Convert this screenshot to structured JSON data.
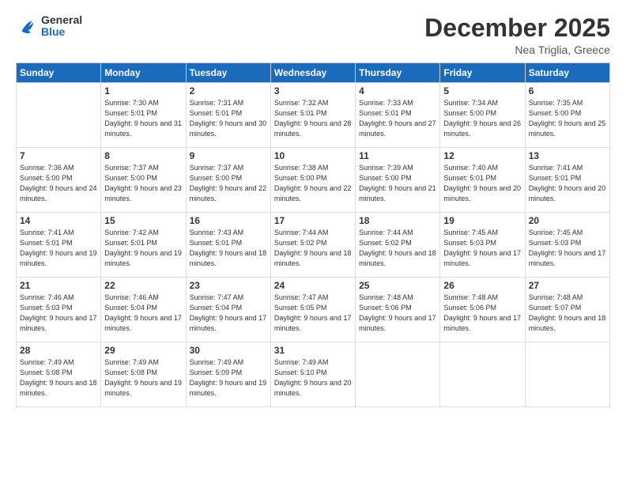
{
  "logo": {
    "line1": "General",
    "line2": "Blue"
  },
  "header": {
    "month": "December 2025",
    "location": "Nea Triglia, Greece"
  },
  "weekdays": [
    "Sunday",
    "Monday",
    "Tuesday",
    "Wednesday",
    "Thursday",
    "Friday",
    "Saturday"
  ],
  "weeks": [
    [
      {
        "day": "",
        "sunrise": "",
        "sunset": "",
        "daylight": ""
      },
      {
        "day": "1",
        "sunrise": "Sunrise: 7:30 AM",
        "sunset": "Sunset: 5:01 PM",
        "daylight": "Daylight: 9 hours and 31 minutes."
      },
      {
        "day": "2",
        "sunrise": "Sunrise: 7:31 AM",
        "sunset": "Sunset: 5:01 PM",
        "daylight": "Daylight: 9 hours and 30 minutes."
      },
      {
        "day": "3",
        "sunrise": "Sunrise: 7:32 AM",
        "sunset": "Sunset: 5:01 PM",
        "daylight": "Daylight: 9 hours and 28 minutes."
      },
      {
        "day": "4",
        "sunrise": "Sunrise: 7:33 AM",
        "sunset": "Sunset: 5:01 PM",
        "daylight": "Daylight: 9 hours and 27 minutes."
      },
      {
        "day": "5",
        "sunrise": "Sunrise: 7:34 AM",
        "sunset": "Sunset: 5:00 PM",
        "daylight": "Daylight: 9 hours and 26 minutes."
      },
      {
        "day": "6",
        "sunrise": "Sunrise: 7:35 AM",
        "sunset": "Sunset: 5:00 PM",
        "daylight": "Daylight: 9 hours and 25 minutes."
      }
    ],
    [
      {
        "day": "7",
        "sunrise": "Sunrise: 7:36 AM",
        "sunset": "Sunset: 5:00 PM",
        "daylight": "Daylight: 9 hours and 24 minutes."
      },
      {
        "day": "8",
        "sunrise": "Sunrise: 7:37 AM",
        "sunset": "Sunset: 5:00 PM",
        "daylight": "Daylight: 9 hours and 23 minutes."
      },
      {
        "day": "9",
        "sunrise": "Sunrise: 7:37 AM",
        "sunset": "Sunset: 5:00 PM",
        "daylight": "Daylight: 9 hours and 22 minutes."
      },
      {
        "day": "10",
        "sunrise": "Sunrise: 7:38 AM",
        "sunset": "Sunset: 5:00 PM",
        "daylight": "Daylight: 9 hours and 22 minutes."
      },
      {
        "day": "11",
        "sunrise": "Sunrise: 7:39 AM",
        "sunset": "Sunset: 5:00 PM",
        "daylight": "Daylight: 9 hours and 21 minutes."
      },
      {
        "day": "12",
        "sunrise": "Sunrise: 7:40 AM",
        "sunset": "Sunset: 5:01 PM",
        "daylight": "Daylight: 9 hours and 20 minutes."
      },
      {
        "day": "13",
        "sunrise": "Sunrise: 7:41 AM",
        "sunset": "Sunset: 5:01 PM",
        "daylight": "Daylight: 9 hours and 20 minutes."
      }
    ],
    [
      {
        "day": "14",
        "sunrise": "Sunrise: 7:41 AM",
        "sunset": "Sunset: 5:01 PM",
        "daylight": "Daylight: 9 hours and 19 minutes."
      },
      {
        "day": "15",
        "sunrise": "Sunrise: 7:42 AM",
        "sunset": "Sunset: 5:01 PM",
        "daylight": "Daylight: 9 hours and 19 minutes."
      },
      {
        "day": "16",
        "sunrise": "Sunrise: 7:43 AM",
        "sunset": "Sunset: 5:01 PM",
        "daylight": "Daylight: 9 hours and 18 minutes."
      },
      {
        "day": "17",
        "sunrise": "Sunrise: 7:44 AM",
        "sunset": "Sunset: 5:02 PM",
        "daylight": "Daylight: 9 hours and 18 minutes."
      },
      {
        "day": "18",
        "sunrise": "Sunrise: 7:44 AM",
        "sunset": "Sunset: 5:02 PM",
        "daylight": "Daylight: 9 hours and 18 minutes."
      },
      {
        "day": "19",
        "sunrise": "Sunrise: 7:45 AM",
        "sunset": "Sunset: 5:03 PM",
        "daylight": "Daylight: 9 hours and 17 minutes."
      },
      {
        "day": "20",
        "sunrise": "Sunrise: 7:45 AM",
        "sunset": "Sunset: 5:03 PM",
        "daylight": "Daylight: 9 hours and 17 minutes."
      }
    ],
    [
      {
        "day": "21",
        "sunrise": "Sunrise: 7:46 AM",
        "sunset": "Sunset: 5:03 PM",
        "daylight": "Daylight: 9 hours and 17 minutes."
      },
      {
        "day": "22",
        "sunrise": "Sunrise: 7:46 AM",
        "sunset": "Sunset: 5:04 PM",
        "daylight": "Daylight: 9 hours and 17 minutes."
      },
      {
        "day": "23",
        "sunrise": "Sunrise: 7:47 AM",
        "sunset": "Sunset: 5:04 PM",
        "daylight": "Daylight: 9 hours and 17 minutes."
      },
      {
        "day": "24",
        "sunrise": "Sunrise: 7:47 AM",
        "sunset": "Sunset: 5:05 PM",
        "daylight": "Daylight: 9 hours and 17 minutes."
      },
      {
        "day": "25",
        "sunrise": "Sunrise: 7:48 AM",
        "sunset": "Sunset: 5:06 PM",
        "daylight": "Daylight: 9 hours and 17 minutes."
      },
      {
        "day": "26",
        "sunrise": "Sunrise: 7:48 AM",
        "sunset": "Sunset: 5:06 PM",
        "daylight": "Daylight: 9 hours and 17 minutes."
      },
      {
        "day": "27",
        "sunrise": "Sunrise: 7:48 AM",
        "sunset": "Sunset: 5:07 PM",
        "daylight": "Daylight: 9 hours and 18 minutes."
      }
    ],
    [
      {
        "day": "28",
        "sunrise": "Sunrise: 7:49 AM",
        "sunset": "Sunset: 5:08 PM",
        "daylight": "Daylight: 9 hours and 18 minutes."
      },
      {
        "day": "29",
        "sunrise": "Sunrise: 7:49 AM",
        "sunset": "Sunset: 5:08 PM",
        "daylight": "Daylight: 9 hours and 19 minutes."
      },
      {
        "day": "30",
        "sunrise": "Sunrise: 7:49 AM",
        "sunset": "Sunset: 5:09 PM",
        "daylight": "Daylight: 9 hours and 19 minutes."
      },
      {
        "day": "31",
        "sunrise": "Sunrise: 7:49 AM",
        "sunset": "Sunset: 5:10 PM",
        "daylight": "Daylight: 9 hours and 20 minutes."
      },
      {
        "day": "",
        "sunrise": "",
        "sunset": "",
        "daylight": ""
      },
      {
        "day": "",
        "sunrise": "",
        "sunset": "",
        "daylight": ""
      },
      {
        "day": "",
        "sunrise": "",
        "sunset": "",
        "daylight": ""
      }
    ]
  ]
}
